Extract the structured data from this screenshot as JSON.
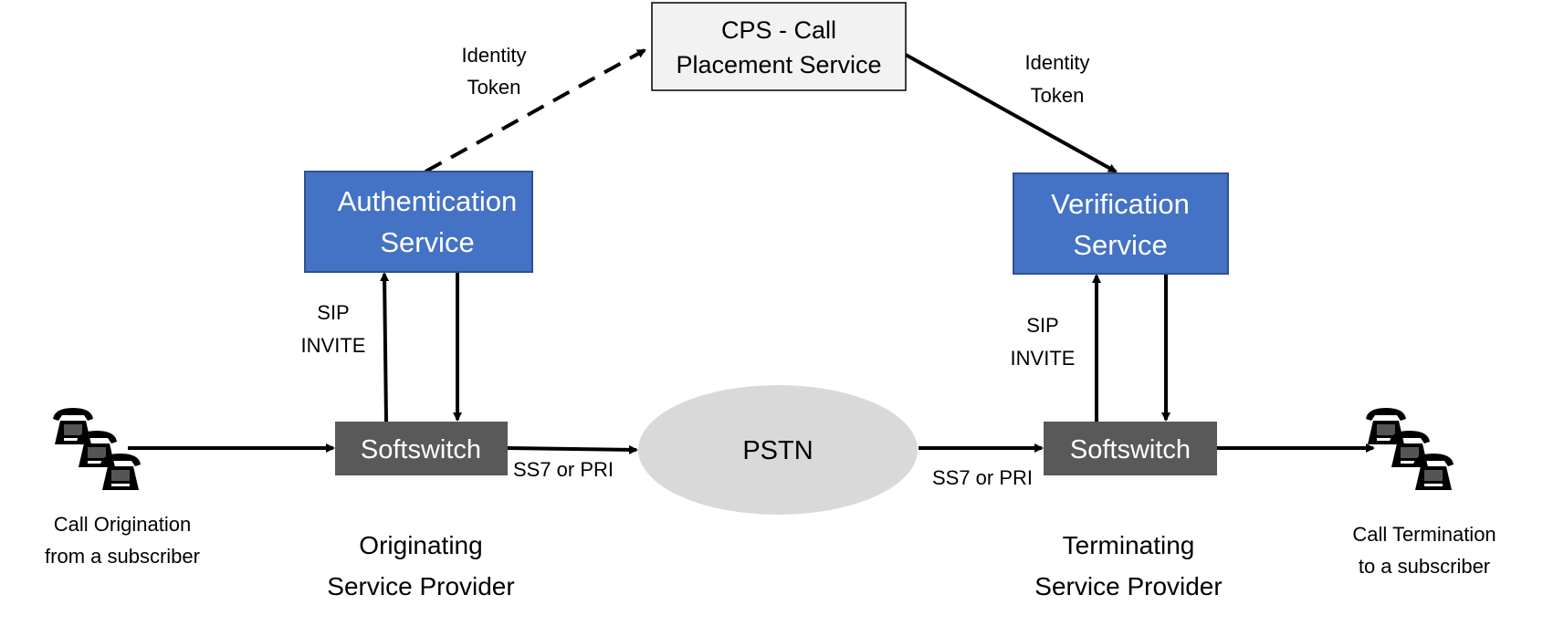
{
  "colors": {
    "service_box": "#4472C4",
    "service_border": "#2F528F",
    "softswitch": "#595959",
    "pstn": "#D9D9D9",
    "cps_box": "#F2F2F2"
  },
  "cps": {
    "line1": "CPS - Call",
    "line2": "Placement Service"
  },
  "identity_left": {
    "line1": "Identity",
    "line2": "Token"
  },
  "identity_right": {
    "line1": "Identity",
    "line2": "Token"
  },
  "auth": {
    "line1": "Authentication",
    "line2": "Service"
  },
  "verif": {
    "line1": "Verification",
    "line2": "Service"
  },
  "sip_left": {
    "line1": "SIP",
    "line2": "INVITE"
  },
  "sip_right": {
    "line1": "SIP",
    "line2": "INVITE"
  },
  "softswitch_left": "Softswitch",
  "softswitch_right": "Softswitch",
  "pstn": "PSTN",
  "ss7_left": "SS7 or PRI",
  "ss7_right": "SS7 or PRI",
  "origination": {
    "line1": "Call Origination",
    "line2": "from a subscriber"
  },
  "termination": {
    "line1": "Call Termination",
    "line2": "to a subscriber"
  },
  "osp": {
    "line1": "Originating",
    "line2": "Service Provider"
  },
  "tsp": {
    "line1": "Terminating",
    "line2": "Service Provider"
  },
  "icons": {
    "phones": "telephone-icon"
  }
}
